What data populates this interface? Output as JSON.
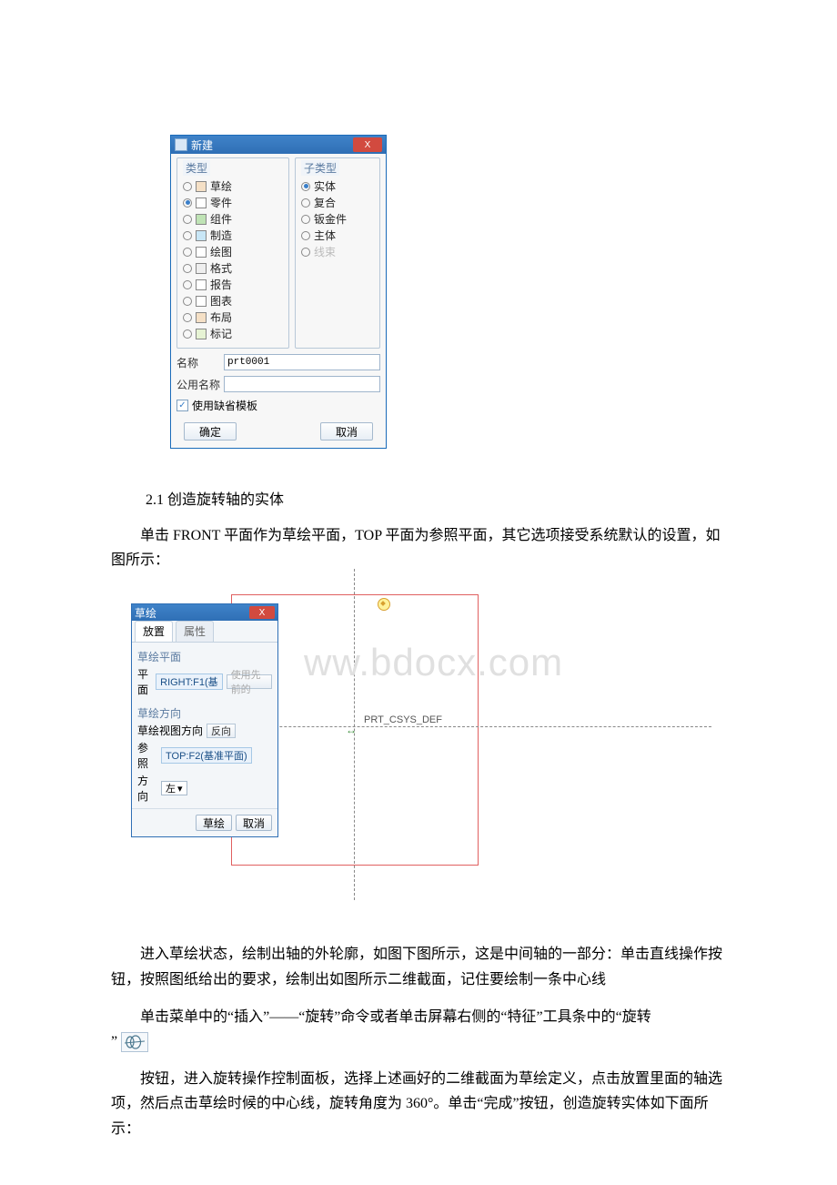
{
  "fig1": {
    "dialog_title": "新建",
    "type_group": "类型",
    "subtype_group": "子类型",
    "types": [
      {
        "id": "sketch",
        "icon": "mi-sketch",
        "label": "草绘",
        "on": false
      },
      {
        "id": "part",
        "icon": "mi-part",
        "label": "零件",
        "on": true
      },
      {
        "id": "asm",
        "icon": "mi-asm",
        "label": "组件",
        "on": false
      },
      {
        "id": "mfg",
        "icon": "mi-mfg",
        "label": "制造",
        "on": false
      },
      {
        "id": "drw",
        "icon": "mi-drw",
        "label": "绘图",
        "on": false
      },
      {
        "id": "fmt",
        "icon": "mi-fmt",
        "label": "格式",
        "on": false
      },
      {
        "id": "rpt",
        "icon": "mi-rpt",
        "label": "报告",
        "on": false
      },
      {
        "id": "chart",
        "icon": "mi-chart",
        "label": "图表",
        "on": false
      },
      {
        "id": "lay",
        "icon": "mi-lay",
        "label": "布局",
        "on": false
      },
      {
        "id": "mrk",
        "icon": "mi-mrk",
        "label": "标记",
        "on": false
      }
    ],
    "subtypes": [
      {
        "label": "实体",
        "on": true,
        "disabled": false
      },
      {
        "label": "复合",
        "on": false,
        "disabled": false
      },
      {
        "label": "钣金件",
        "on": false,
        "disabled": false
      },
      {
        "label": "主体",
        "on": false,
        "disabled": false
      },
      {
        "label": "线束",
        "on": false,
        "disabled": true
      }
    ],
    "name_label": "名称",
    "name_value": "prt0001",
    "common_name_label": "公用名称",
    "common_name_value": "",
    "use_default_template": "使用缺省模板",
    "ok": "确定",
    "cancel": "取消",
    "close_x": "X"
  },
  "sec21_heading": "2.1 创造旋转轴的实体",
  "para1": "单击 FRONT 平面作为草绘平面，TOP 平面为参照平面，其它选项接受系统默认的设置，如图所示：",
  "watermark": "ww.bdocx.com",
  "fig2": {
    "dialog_title": "草绘",
    "close_x": "X",
    "tab_active": "放置",
    "tab_inactive": "属性",
    "sketch_plane_title": "草绘平面",
    "plane_label": "平面",
    "plane_value": "RIGHT:F1(基",
    "use_prev_btn": "使用先前的",
    "sketch_dir_title": "草绘方向",
    "view_dir_label": "草绘视图方向",
    "flip_btn": "反向",
    "ref_label": "参照",
    "ref_value": "TOP:F2(基准平面)",
    "orient_label": "方向",
    "orient_value": "左",
    "sketch_btn": "草绘",
    "cancel_btn": "取消",
    "csys_label": "PRT_CSYS_DEF"
  },
  "para2": "进入草绘状态，绘制出轴的外轮廓，如图下图所示，这是中间轴的一部分：单击直线操作按钮，按照图纸给出的要求，绘制出如图所示二维截面，记住要绘制一条中心线",
  "para3_a": "单击菜单中的“插入”——“旋转”命令或者单击屏幕右侧的“特征”工具条中的“旋转",
  "para3_b": "”",
  "para4": "按钮，进入旋转操作控制面板，选择上述画好的二维截面为草绘定义，点击放置里面的轴选项，然后点击草绘时候的中心线，旋转角度为 360°。单击“完成”按钮，创造旋转实体如下面所示："
}
